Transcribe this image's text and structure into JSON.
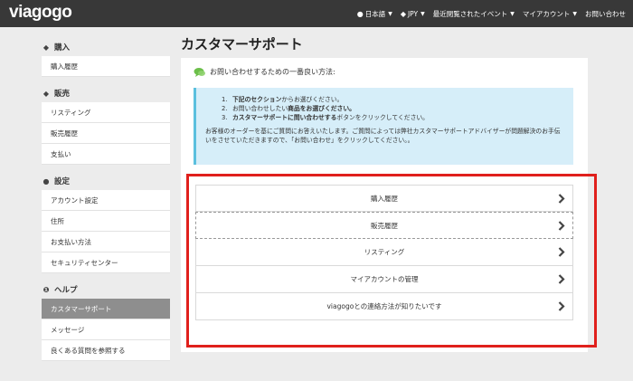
{
  "header": {
    "logo": "viagogo",
    "nav": [
      {
        "icon": "globe-icon",
        "label": "日本語"
      },
      {
        "icon": "yen-icon",
        "label": "JPY"
      },
      {
        "icon": "",
        "label": "最近閲覧されたイベント"
      },
      {
        "icon": "",
        "label": "マイアカウント"
      },
      {
        "icon": "",
        "label": "お問い合わせ"
      }
    ]
  },
  "sidebar": {
    "purchase": {
      "title": "購入",
      "items": [
        "購入履歴"
      ]
    },
    "sales": {
      "title": "販売",
      "items": [
        "リスティング",
        "販売履歴",
        "支払い"
      ]
    },
    "settings": {
      "title": "設定",
      "items": [
        "アカウント設定",
        "住所",
        "お支払い方法",
        "セキュリティセンター"
      ]
    },
    "help": {
      "title": "ヘルプ",
      "items": [
        "カスタマーサポート",
        "メッセージ",
        "良くある質問を参照する"
      ],
      "active": "カスタマーサポート"
    }
  },
  "main": {
    "title": "カスタマーサポート",
    "howto": "お問い合わせするための一番良い方法:",
    "steps": [
      {
        "num": "1.",
        "bold": "下記のセクション",
        "rest": "からお選びください。"
      },
      {
        "num": "2.",
        "bold": "",
        "rest": "お問い合わせしたい",
        "bold2": "商品をお選びください。"
      },
      {
        "num": "3.",
        "bold": "カスタマーサポートに問い合わせする",
        "rest": "ボタンをクリックしてください。"
      }
    ],
    "note": "お客様のオーダーを基にご質問にお答えいたします。ご質問によっては弊社カスタマーサポートアドバイザーが問題解決のお手伝いをさせていただきますので、「お問い合わせ」をクリックしてください。。",
    "menu": [
      "購入履歴",
      "販売履歴",
      "リスティング",
      "マイアカウントの管理",
      "viagogoとの連絡方法が知りたいです"
    ]
  },
  "colors": {
    "topbar": "#383838",
    "info": "#d6eef9",
    "infoBorder": "#5bc0de",
    "highlight": "#e0201c",
    "active": "#8e8e8e"
  }
}
